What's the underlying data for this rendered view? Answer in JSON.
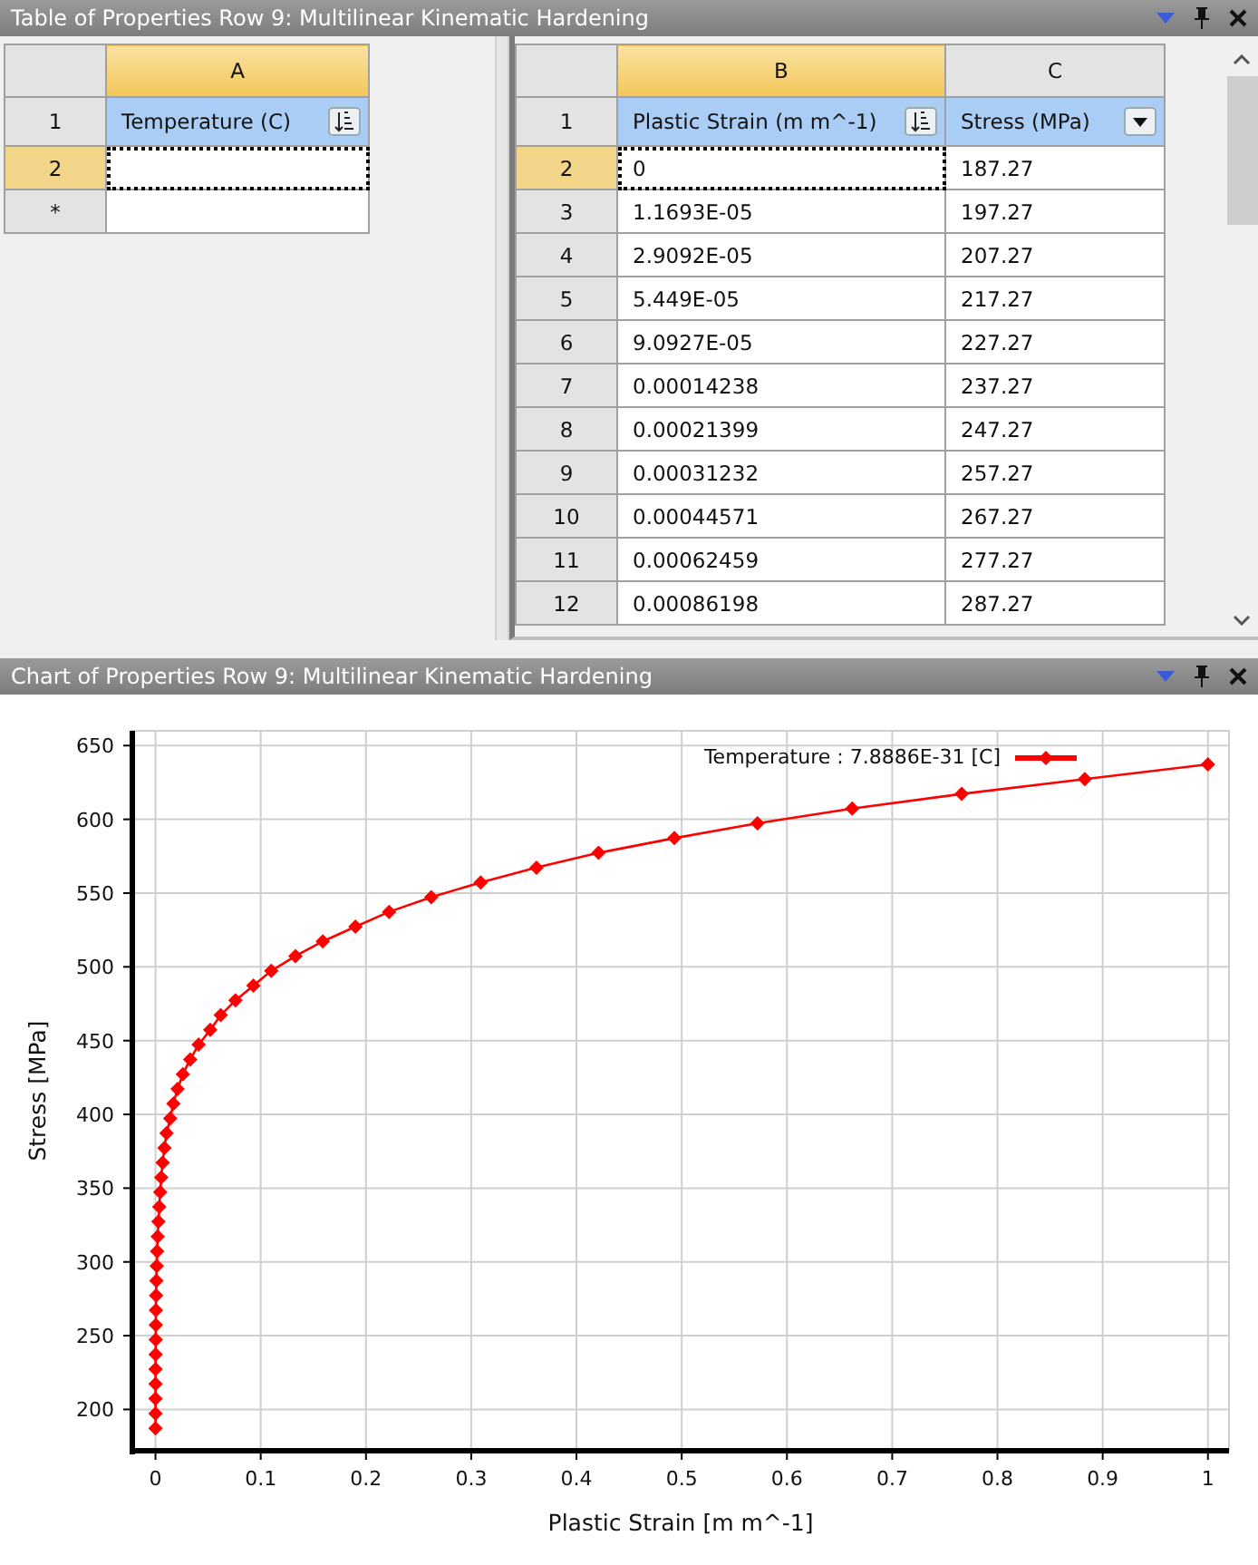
{
  "table_panel": {
    "title": "Table of Properties Row 9: Multilinear Kinematic Hardening",
    "left_table": {
      "columns": [
        {
          "letter": "A",
          "selected": true
        }
      ],
      "header_row": {
        "number": "1",
        "cells": [
          {
            "label": "Temperature (C)",
            "kind": "sort"
          }
        ]
      },
      "rows": [
        {
          "number": "2",
          "selected": true
        },
        {
          "number": "*",
          "selected": false
        }
      ]
    },
    "right_table": {
      "columns": [
        {
          "letter": "B",
          "selected": true
        },
        {
          "letter": "C",
          "selected": false
        }
      ],
      "header_row": {
        "number": "1",
        "cells": [
          {
            "label": "Plastic Strain (m m^-1)",
            "kind": "sort"
          },
          {
            "label": "Stress (MPa)",
            "kind": "dropdown"
          }
        ]
      },
      "rows": [
        {
          "number": "2",
          "selected": true,
          "cells": [
            "0",
            "187.27"
          ]
        },
        {
          "number": "3",
          "selected": false,
          "cells": [
            "1.1693E-05",
            "197.27"
          ]
        },
        {
          "number": "4",
          "selected": false,
          "cells": [
            "2.9092E-05",
            "207.27"
          ]
        },
        {
          "number": "5",
          "selected": false,
          "cells": [
            "5.449E-05",
            "217.27"
          ]
        },
        {
          "number": "6",
          "selected": false,
          "cells": [
            "9.0927E-05",
            "227.27"
          ]
        },
        {
          "number": "7",
          "selected": false,
          "cells": [
            "0.00014238",
            "237.27"
          ]
        },
        {
          "number": "8",
          "selected": false,
          "cells": [
            "0.00021399",
            "247.27"
          ]
        },
        {
          "number": "9",
          "selected": false,
          "cells": [
            "0.00031232",
            "257.27"
          ]
        },
        {
          "number": "10",
          "selected": false,
          "cells": [
            "0.00044571",
            "267.27"
          ]
        },
        {
          "number": "11",
          "selected": false,
          "cells": [
            "0.00062459",
            "277.27"
          ]
        },
        {
          "number": "12",
          "selected": false,
          "cells": [
            "0.00086198",
            "287.27"
          ]
        }
      ]
    }
  },
  "chart_panel": {
    "title": "Chart of Properties Row 9: Multilinear Kinematic Hardening",
    "chart_data": {
      "type": "line",
      "grid": true,
      "xlabel": "Plastic Strain  [m m^-1]",
      "ylabel": "Stress  [MPa]",
      "x": [
        0,
        1.1693e-05,
        2.9092e-05,
        5.449e-05,
        9.0927e-05,
        0.00014238,
        0.00021399,
        0.00031232,
        0.00044571,
        0.00062459,
        0.00086198,
        0.0012,
        0.0016,
        0.0021,
        0.0028,
        0.0036,
        0.0045,
        0.0055,
        0.0068,
        0.0085,
        0.0105,
        0.014,
        0.017,
        0.021,
        0.026,
        0.033,
        0.041,
        0.052,
        0.062,
        0.076,
        0.093,
        0.11,
        0.133,
        0.159,
        0.19,
        0.222,
        0.262,
        0.309,
        0.362,
        0.421,
        0.493,
        0.572,
        0.662,
        0.766,
        0.883,
        1.0
      ],
      "series": [
        {
          "name": "Temperature : 7.8886E-31 [C]",
          "color": "#ff0000",
          "marker": "diamond",
          "values": [
            187.27,
            197.27,
            207.27,
            217.27,
            227.27,
            237.27,
            247.27,
            257.27,
            267.27,
            277.27,
            287.27,
            297.27,
            307.27,
            317.27,
            327.27,
            337.27,
            347.27,
            357.27,
            367.27,
            377.27,
            387.27,
            397.27,
            407.27,
            417.27,
            427.27,
            437.27,
            447.27,
            457.27,
            467.27,
            477.27,
            487.27,
            497.27,
            507.27,
            517.27,
            527.27,
            537.27,
            547.27,
            557.27,
            567.27,
            577.27,
            587.27,
            597.27,
            607.27,
            617.27,
            627.27,
            637.27
          ]
        }
      ],
      "xlim": [
        -0.022,
        1.02
      ],
      "ylim": [
        172,
        660
      ],
      "xticks": [
        0,
        0.1,
        0.2,
        0.3,
        0.4,
        0.5,
        0.6,
        0.7,
        0.8,
        0.9,
        1
      ],
      "yticks": [
        200,
        250,
        300,
        350,
        400,
        450,
        500,
        550,
        600,
        650
      ]
    }
  }
}
